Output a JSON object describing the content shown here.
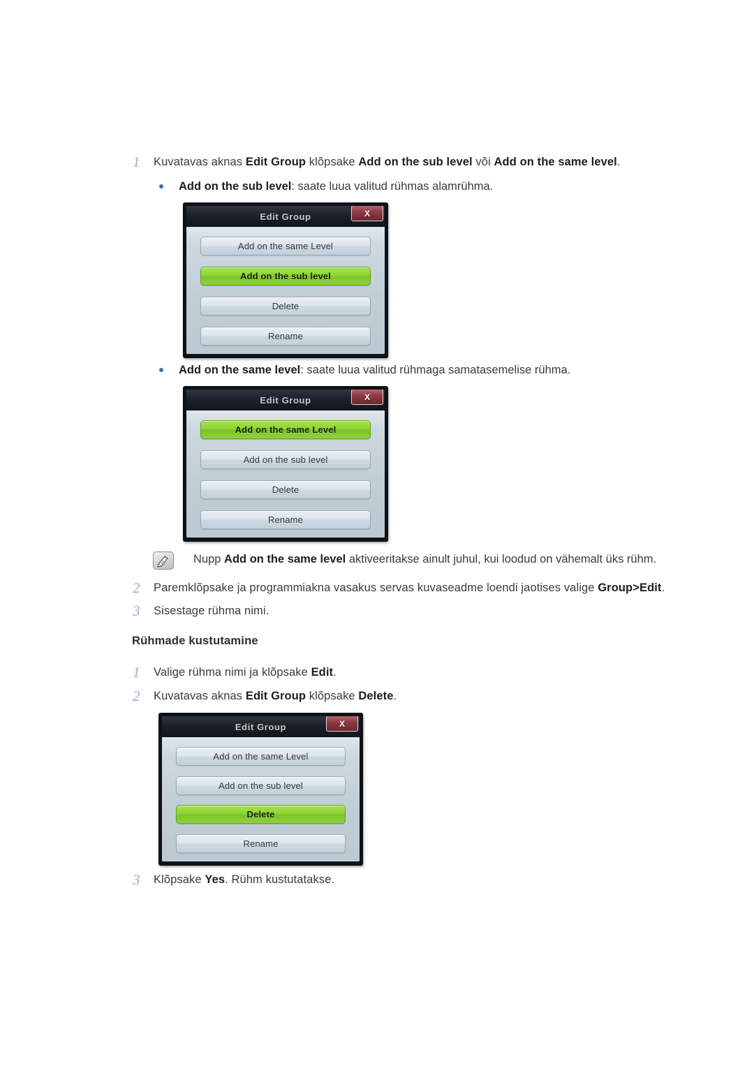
{
  "steps": {
    "s1": {
      "num": "1",
      "parts": [
        {
          "t": "Kuvatavas aknas ",
          "b": false
        },
        {
          "t": "Edit Group",
          "b": true
        },
        {
          "t": " klõpsake ",
          "b": false
        },
        {
          "t": "Add on the sub level",
          "b": true
        },
        {
          "t": " või ",
          "b": false
        },
        {
          "t": "Add on the same level",
          "b": true
        },
        {
          "t": ".",
          "b": false
        }
      ]
    },
    "b1": {
      "parts": [
        {
          "t": "Add on the sub level",
          "b": true
        },
        {
          "t": ": saate luua valitud rühmas alamrühma.",
          "b": false
        }
      ]
    },
    "b2": {
      "parts": [
        {
          "t": "Add on the same level",
          "b": true
        },
        {
          "t": ": saate luua valitud rühmaga samatasemelise rühma.",
          "b": false
        }
      ]
    },
    "note": {
      "icon": "note-pencil-icon",
      "parts": [
        {
          "t": "Nupp ",
          "b": false
        },
        {
          "t": "Add on the same level",
          "b": true
        },
        {
          "t": " aktiveeritakse ainult juhul, kui loodud on vähemalt üks rühm.",
          "b": false
        }
      ]
    },
    "s2": {
      "num": "2",
      "parts": [
        {
          "t": "Paremklõpsake ja programmiakna vasakus servas kuvaseadme loendi jaotises valige ",
          "b": false
        },
        {
          "t": "Group>Edit",
          "b": true
        },
        {
          "t": ".",
          "b": false
        }
      ]
    },
    "s3": {
      "num": "3",
      "parts": [
        {
          "t": "Sisestage rühma nimi.",
          "b": false
        }
      ]
    },
    "heading": "Rühmade kustutamine",
    "d1": {
      "num": "1",
      "parts": [
        {
          "t": "Valige rühma nimi ja klõpsake ",
          "b": false
        },
        {
          "t": "Edit",
          "b": true
        },
        {
          "t": ".",
          "b": false
        }
      ]
    },
    "d2": {
      "num": "2",
      "parts": [
        {
          "t": "Kuvatavas aknas ",
          "b": false
        },
        {
          "t": "Edit Group",
          "b": true
        },
        {
          "t": " klõpsake ",
          "b": false
        },
        {
          "t": "Delete",
          "b": true
        },
        {
          "t": ".",
          "b": false
        }
      ]
    },
    "d3": {
      "num": "3",
      "parts": [
        {
          "t": "Klõpsake ",
          "b": false
        },
        {
          "t": "Yes",
          "b": true
        },
        {
          "t": ". Rühm kustutatakse.",
          "b": false
        }
      ]
    }
  },
  "dialogs": [
    {
      "id": "dialog-add-sub-level",
      "title": "Edit Group",
      "close_label": "X",
      "buttons": [
        {
          "label": "Add on the same Level",
          "selected": false
        },
        {
          "label": "Add on the sub level",
          "selected": true
        },
        {
          "label": "Delete",
          "selected": false
        },
        {
          "label": "Rename",
          "selected": false
        }
      ]
    },
    {
      "id": "dialog-add-same-level",
      "title": "Edit Group",
      "close_label": "X",
      "buttons": [
        {
          "label": "Add on the same Level",
          "selected": true
        },
        {
          "label": "Add on the sub level",
          "selected": false
        },
        {
          "label": "Delete",
          "selected": false
        },
        {
          "label": "Rename",
          "selected": false
        }
      ]
    },
    {
      "id": "dialog-delete",
      "title": "Edit Group",
      "close_label": "X",
      "buttons": [
        {
          "label": "Add on the same Level",
          "selected": false
        },
        {
          "label": "Add on the sub level",
          "selected": false
        },
        {
          "label": "Delete",
          "selected": true
        },
        {
          "label": "Rename",
          "selected": false
        }
      ]
    }
  ],
  "colors": {
    "step_number": "#9fa4e4",
    "bullet": "#3c6fa6",
    "selected_button_green": "#8fd338",
    "close_button_red": "#8e3c44",
    "dialog_titlebar": "#1d2228",
    "dialog_body": "#c2ced6"
  }
}
